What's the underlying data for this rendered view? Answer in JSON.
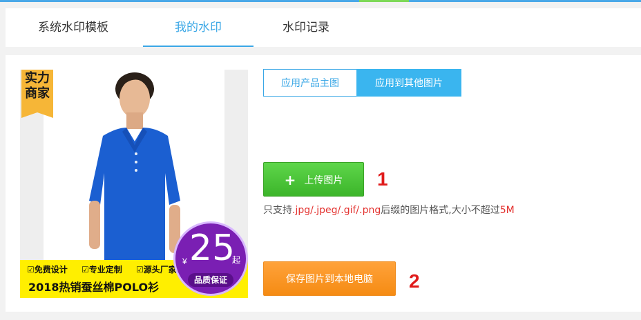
{
  "tabs": [
    {
      "label": "系统水印模板",
      "active": false
    },
    {
      "label": "我的水印",
      "active": true
    },
    {
      "label": "水印记录",
      "active": false
    }
  ],
  "product_image": {
    "badge": [
      "实力",
      "商家"
    ],
    "features": [
      "免费设计",
      "专业定制",
      "源头厂家"
    ],
    "headline": "2018热销蚕丝棉POLO衫",
    "price": {
      "currency": "¥",
      "number": "25",
      "unit": "起",
      "label": "品质保证"
    }
  },
  "apply_toggle": {
    "option1": "应用产品主图",
    "option2": "应用到其他图片",
    "selected": "应用到其他图片"
  },
  "upload": {
    "icon": "plus-icon",
    "label": "上传图片",
    "step": "1"
  },
  "hint": {
    "prefix": "只支持",
    "formats": ".jpg/.jpeg/.gif/.png",
    "middle": "后缀的图片格式,大小不超过",
    "size": "5M"
  },
  "save": {
    "label": "保存图片到本地电脑",
    "step": "2"
  },
  "colors": {
    "accent": "#3aa7e6",
    "upload": "#4cc83a",
    "save": "#f79620",
    "step_number": "#e01b1b",
    "price_badge": "#7a1fb3",
    "banner": "#ffef00"
  }
}
